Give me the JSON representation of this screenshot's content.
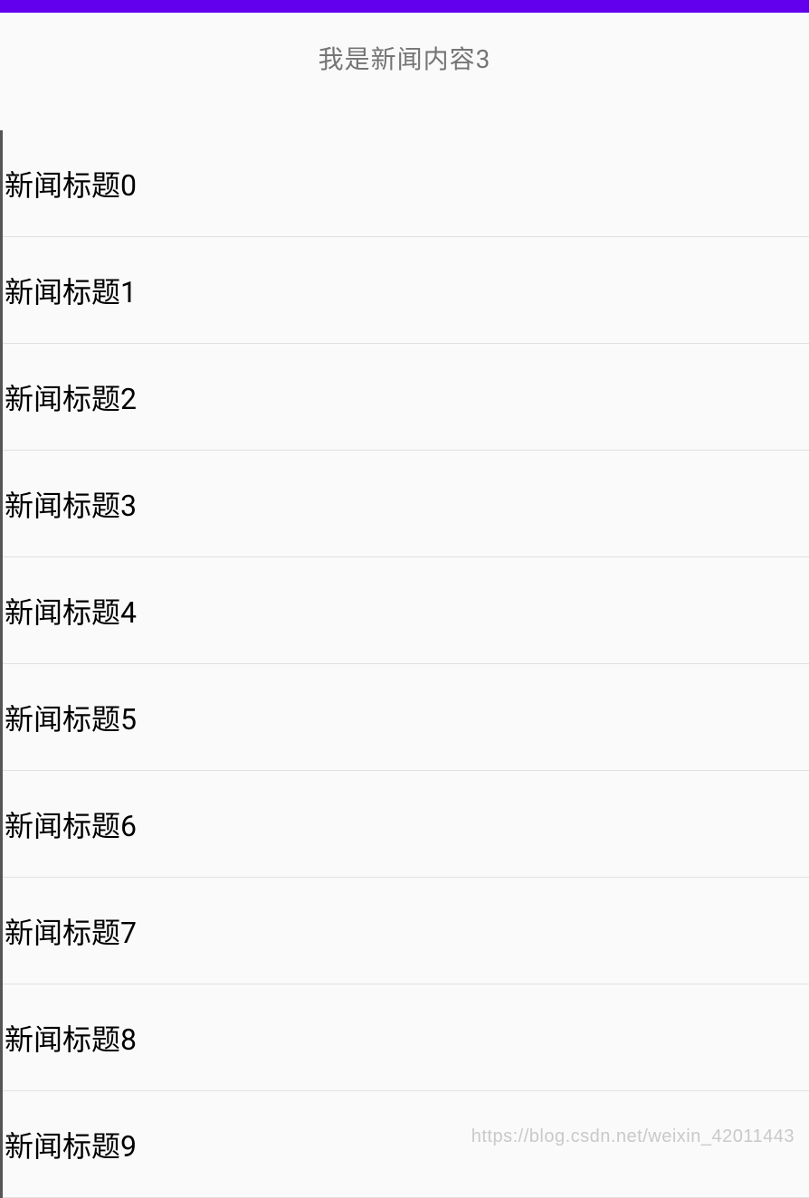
{
  "header": {
    "content_label": "我是新闻内容3"
  },
  "list": {
    "items": [
      {
        "title": "新闻标题0"
      },
      {
        "title": "新闻标题1"
      },
      {
        "title": "新闻标题2"
      },
      {
        "title": "新闻标题3"
      },
      {
        "title": "新闻标题4"
      },
      {
        "title": "新闻标题5"
      },
      {
        "title": "新闻标题6"
      },
      {
        "title": "新闻标题7"
      },
      {
        "title": "新闻标题8"
      },
      {
        "title": "新闻标题9"
      }
    ]
  },
  "watermark": "https://blog.csdn.net/weixin_42011443"
}
